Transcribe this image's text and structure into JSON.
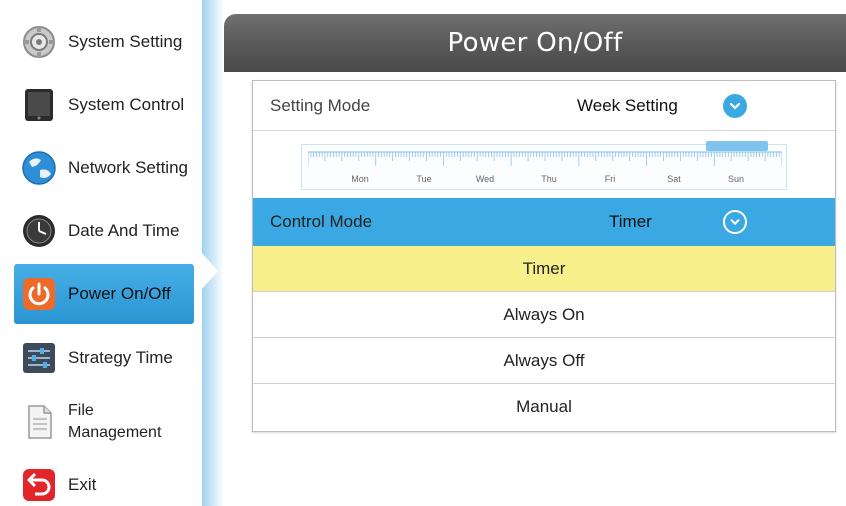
{
  "sidebar": {
    "items": [
      {
        "label": "System Setting",
        "icon": "gear-icon"
      },
      {
        "label": "System Control",
        "icon": "tablet-icon"
      },
      {
        "label": "Network Setting",
        "icon": "globe-icon"
      },
      {
        "label": "Date And Time",
        "icon": "clock-icon"
      },
      {
        "label": "Power On/Off",
        "icon": "power-icon",
        "active": true
      },
      {
        "label": "Strategy Time",
        "icon": "sliders-icon"
      },
      {
        "label": "File\nManagement",
        "icon": "document-icon"
      },
      {
        "label": "Exit",
        "icon": "exit-icon"
      }
    ]
  },
  "header": {
    "title": "Power On/Off"
  },
  "setting_mode": {
    "label": "Setting Mode",
    "value": "Week Setting"
  },
  "timeline": {
    "days": [
      "Mon",
      "Tue",
      "Wed",
      "Thu",
      "Fri",
      "Sat",
      "Sun"
    ]
  },
  "control_mode": {
    "label": "Control Mode",
    "value": "Timer"
  },
  "options": [
    {
      "label": "Timer",
      "selected": true
    },
    {
      "label": "Always On"
    },
    {
      "label": "Always Off"
    },
    {
      "label": "Manual"
    }
  ],
  "colors": {
    "accent": "#3aa8e3",
    "selected_option": "#f8f08a",
    "header": "#595959"
  }
}
